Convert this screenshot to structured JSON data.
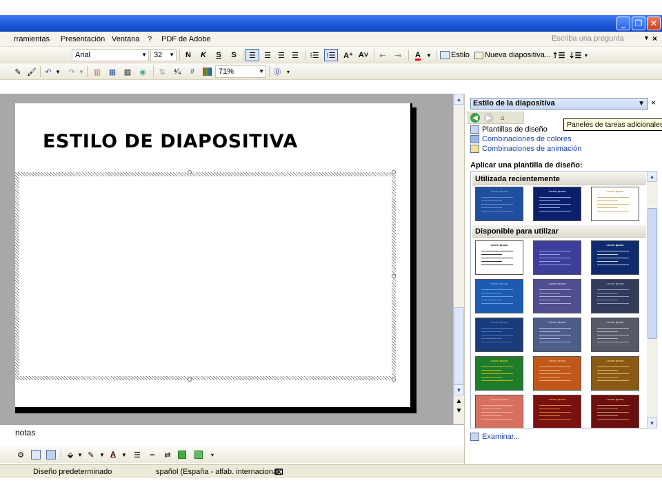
{
  "menu": {
    "items": [
      "rramientas",
      "Presentación",
      "Ventana",
      "?",
      "PDF de Adobe"
    ],
    "help_placeholder": "Escriba una pregunta"
  },
  "toolbar_format": {
    "font": "Arial",
    "size": "32",
    "bold": "N",
    "italic": "K",
    "underline": "S",
    "shadow": "S",
    "style_button": "Estilo",
    "new_slide_button": "Nueva diapositiva..."
  },
  "toolbar_standard": {
    "zoom": "71%"
  },
  "slide": {
    "title": "ESTILO DE DIAPOSITIVA"
  },
  "notes": {
    "label": "notas"
  },
  "statusbar": {
    "design": "Diseño predeterminado",
    "language": "spañol (España - alfab. internacional"
  },
  "taskpane": {
    "title": "Estilo de la diapositiva",
    "links": [
      "Plantillas de diseño",
      "Combinaciones de colores",
      "Combinaciones de animación"
    ],
    "apply_label": "Aplicar una plantilla de diseño:",
    "recent_label": "Utilizada recientemente",
    "available_label": "Disponible para utilizar",
    "browse": "Examinar...",
    "tooltip": "Paneles de tareas adicionales",
    "recent_thumbs": [
      {
        "bg": "#1f4f9e",
        "accent": "#6f9ee0",
        "title": "Lorem Ipsum"
      },
      {
        "bg": "#0b1f6b",
        "accent": "#c7d3ff",
        "title": "Lorem Ipsum"
      },
      {
        "bg": "#ffffff",
        "accent": "#c8a24a",
        "title": "Lorem Ipsum"
      }
    ],
    "available_thumbs": [
      {
        "bg": "#ffffff",
        "accent": "#000000",
        "title": "Lorem Ipsum"
      },
      {
        "bg": "#3d3f9a",
        "accent": "#b5b8ff",
        "title": ""
      },
      {
        "bg": "#0f2a6e",
        "accent": "#ffffff",
        "title": "Lorem Ipsum"
      },
      {
        "bg": "#1c5bb0",
        "accent": "#7ab0f0",
        "title": "Lorem Ipsum"
      },
      {
        "bg": "#4f4f8f",
        "accent": "#c9c9f3",
        "title": "Lorem Ipsum"
      },
      {
        "bg": "#333a5a",
        "accent": "#aab3d6",
        "title": "Lorem Ipsum"
      },
      {
        "bg": "#1a3a7a",
        "accent": "#4b8fe0",
        "title": "Lorem Ipsum"
      },
      {
        "bg": "#4d5d8a",
        "accent": "#c0cff0",
        "title": "Lorem Ipsum"
      },
      {
        "bg": "#555a66",
        "accent": "#c9cdd6",
        "title": "Lorem Ipsum"
      },
      {
        "bg": "#1e7d2a",
        "accent": "#e3c21a",
        "title": "Lorem Ipsum"
      },
      {
        "bg": "#c0581a",
        "accent": "#f3c08a",
        "title": "Lorem Ipsum"
      },
      {
        "bg": "#8a5a14",
        "accent": "#e9c78a",
        "title": "Lorem Ipsum"
      },
      {
        "bg": "#d77060",
        "accent": "#f3c0a0",
        "title": "Lorem Ipsum"
      },
      {
        "bg": "#7a1010",
        "accent": "#e9a020",
        "title": "Lorem Ipsum"
      },
      {
        "bg": "#6b0f0f",
        "accent": "#d4b080",
        "title": "Lorem Ipsum"
      }
    ]
  }
}
